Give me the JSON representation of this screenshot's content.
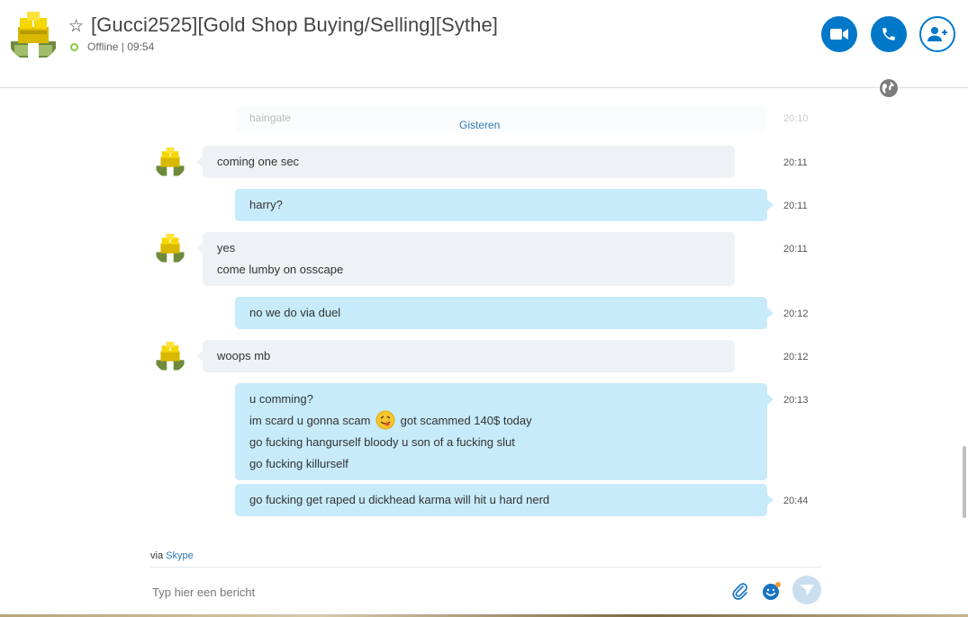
{
  "header": {
    "title": "[Gucci2525][Gold Shop Buying/Selling][Sythe]",
    "status": "Offline | 09:54"
  },
  "chat": {
    "faded_text": "haingate",
    "faded_time": "20:10",
    "day_separator": "Gisteren",
    "messages": [
      {
        "direction": "in",
        "lines": [
          "coming one sec"
        ],
        "time": "20:11"
      },
      {
        "direction": "out",
        "lines": [
          "harry?"
        ],
        "time": "20:11"
      },
      {
        "direction": "in",
        "lines": [
          "yes",
          "come lumby on osscape"
        ],
        "time": "20:11"
      },
      {
        "direction": "out",
        "lines": [
          "no we do via duel"
        ],
        "time": "20:12"
      },
      {
        "direction": "in",
        "lines": [
          "woops mb"
        ],
        "time": "20:12"
      },
      {
        "direction": "out",
        "lines": [
          "u comming?",
          "im scard u gonna scam",
          "got scammed 140$ today",
          "go fucking hangurself bloody u son of a fucking slut",
          "go fucking killurself"
        ],
        "time": "20:13"
      },
      {
        "direction": "out",
        "lines": [
          "go fucking get raped u dickhead karma will hit u hard nerd"
        ],
        "time": "20:44"
      }
    ]
  },
  "footer": {
    "via_prefix": "via",
    "via_link": "Skype",
    "placeholder": "Typ hier een bericht"
  },
  "colors": {
    "accent": "#0078ca",
    "incoming_bubble": "#eef2f5",
    "outgoing_bubble": "#c7ebfa",
    "status_ring": "#8cc63f"
  },
  "icons": {
    "video": "video-camera-icon",
    "call": "phone-icon",
    "add_people": "add-contact-icon",
    "globe": "globe-icon",
    "attach": "paperclip-icon",
    "emoji": "emoticon-icon",
    "send": "send-icon",
    "favorite": "star-outline-icon"
  }
}
